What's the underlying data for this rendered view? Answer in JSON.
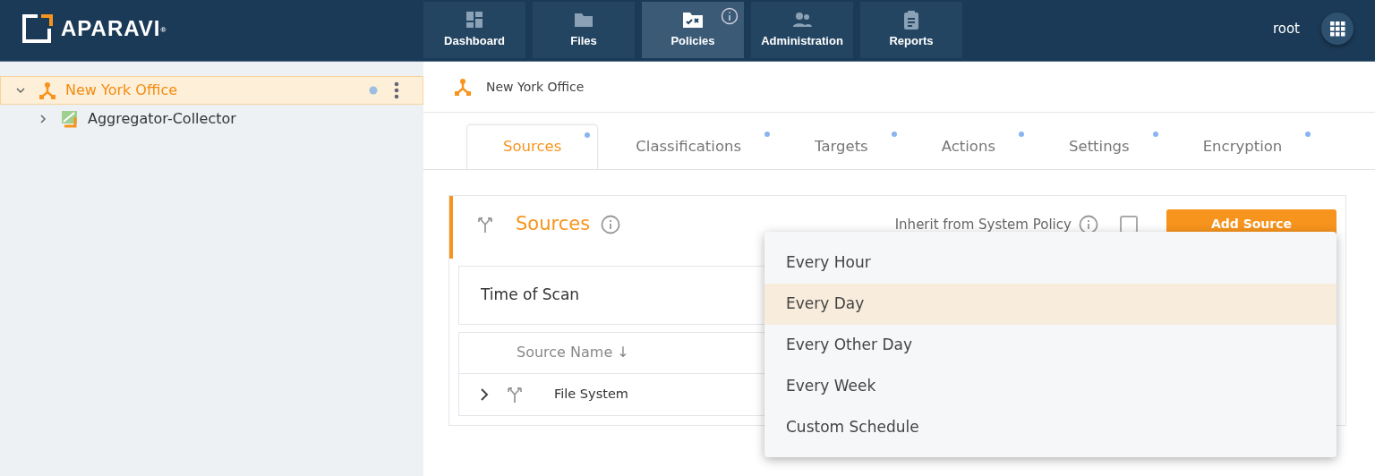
{
  "brand": {
    "name": "APARAVI",
    "mark": "®"
  },
  "nav": [
    {
      "label": "Dashboard",
      "selected": false,
      "info": false
    },
    {
      "label": "Files",
      "selected": false,
      "info": false
    },
    {
      "label": "Policies",
      "selected": true,
      "info": true
    },
    {
      "label": "Administration",
      "selected": false,
      "info": false
    },
    {
      "label": "Reports",
      "selected": false,
      "info": false
    }
  ],
  "user": "root",
  "tree": [
    {
      "label": "New York Office",
      "expanded": true,
      "selected": true,
      "children": [
        {
          "label": "Aggregator-Collector",
          "expanded": false,
          "selected": false
        }
      ]
    }
  ],
  "breadcrumb": "New York Office",
  "tabs": [
    {
      "label": "Sources",
      "selected": true
    },
    {
      "label": "Classifications",
      "selected": false
    },
    {
      "label": "Targets",
      "selected": false
    },
    {
      "label": "Actions",
      "selected": false
    },
    {
      "label": "Settings",
      "selected": false
    },
    {
      "label": "Encryption",
      "selected": false
    }
  ],
  "panel": {
    "title": "Sources",
    "inherit_label": "Inherit from System Policy",
    "inherit_checked": false,
    "add_button": "Add Source",
    "time_of_scan": "Time of Scan",
    "column": "Source Name ↓",
    "rows": [
      {
        "name": "File System",
        "expanded": false
      }
    ]
  },
  "dropdown": [
    {
      "label": "Every Hour",
      "selected": false
    },
    {
      "label": "Every Day",
      "selected": true
    },
    {
      "label": "Every Other Day",
      "selected": false
    },
    {
      "label": "Every Week",
      "selected": false
    },
    {
      "label": "Custom Schedule",
      "selected": false
    }
  ]
}
